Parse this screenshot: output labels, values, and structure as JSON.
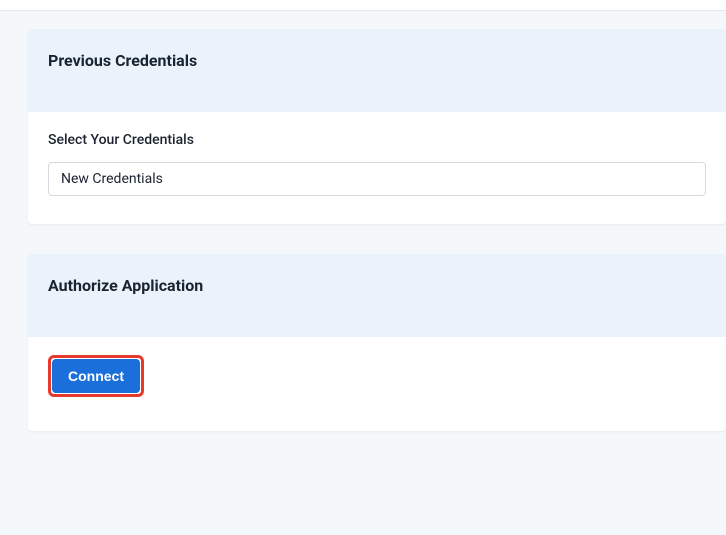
{
  "previousCredentials": {
    "title": "Previous Credentials",
    "selectLabel": "Select Your Credentials",
    "selectedValue": "New Credentials"
  },
  "authorizeApplication": {
    "title": "Authorize Application",
    "connectLabel": "Connect"
  }
}
